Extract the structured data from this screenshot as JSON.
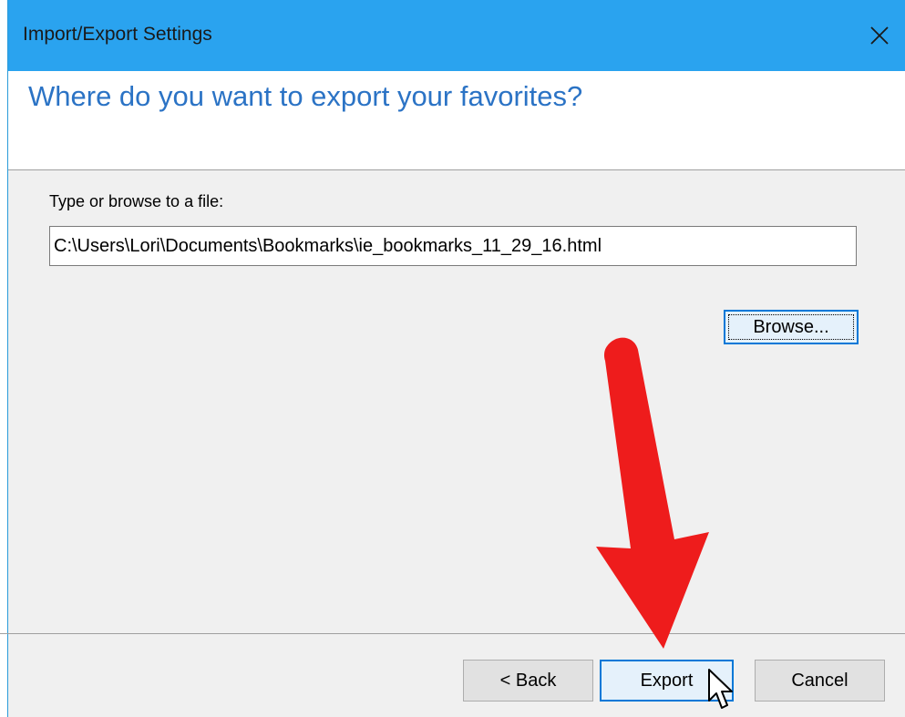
{
  "window": {
    "title": "Import/Export Settings"
  },
  "header": {
    "heading": "Where do you want to export your favorites?"
  },
  "form": {
    "label": "Type or browse to a file:",
    "path_value": "C:\\Users\\Lori\\Documents\\Bookmarks\\ie_bookmarks_11_29_16.html",
    "browse_label": "Browse..."
  },
  "footer": {
    "back_label": "< Back",
    "export_label": "Export",
    "cancel_label": "Cancel"
  },
  "colors": {
    "titlebar": "#2aa3ef",
    "heading": "#2b73c5",
    "arrow": "#ee1c1c",
    "focus_border": "#0078d7"
  },
  "icons": {
    "close": "close-icon",
    "cursor": "arrow-pointer-cursor-icon",
    "annotation": "red-arrow-annotation"
  }
}
